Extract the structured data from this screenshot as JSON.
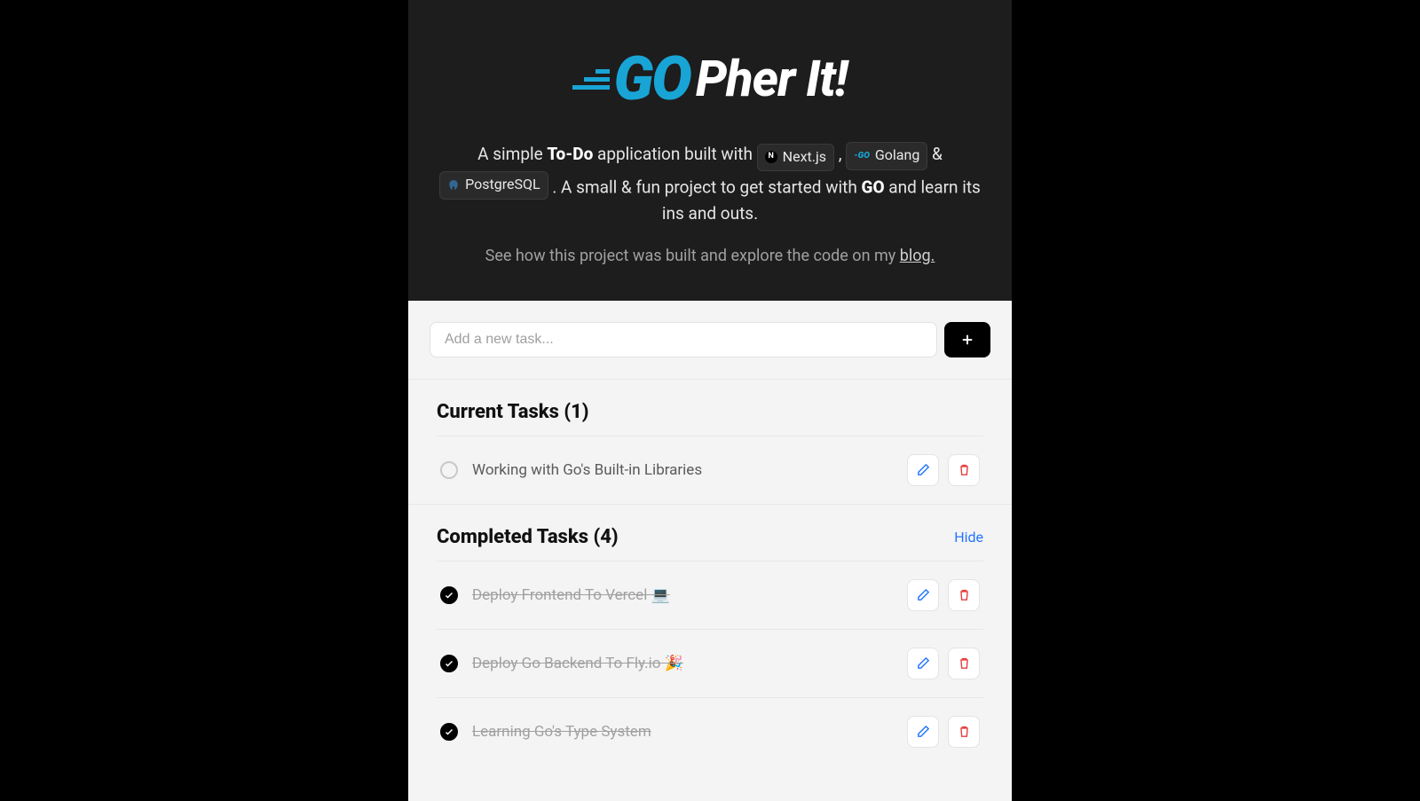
{
  "brand": {
    "go_word": "GO",
    "title_rest": "Pher It!"
  },
  "intro": {
    "p1a": "A simple ",
    "p1b": "To-Do",
    "p1c": " application built with ",
    "tag1": "Next.js",
    "comma": " , ",
    "tag2": "Golang",
    "amp": " & ",
    "tag3": "PostgreSQL",
    "p1d": " . A small & fun project to get started with ",
    "p1e": "GO",
    "p1f": " and learn its ins and outs."
  },
  "blog": {
    "prefix": "See how this project was built and explore the code on my ",
    "link": "blog."
  },
  "add": {
    "placeholder": "Add a new task..."
  },
  "sections": {
    "current_title": "Current Tasks (1)",
    "completed_title": "Completed Tasks (4)",
    "hide": "Hide"
  },
  "current_tasks": [
    {
      "title": "Working with Go's Built-in Libraries"
    }
  ],
  "completed_tasks": [
    {
      "title": "Deploy Frontend To Vercel 💻"
    },
    {
      "title": "Deploy Go Backend To Fly.io 🎉"
    },
    {
      "title": "Learning Go's Type System"
    }
  ]
}
